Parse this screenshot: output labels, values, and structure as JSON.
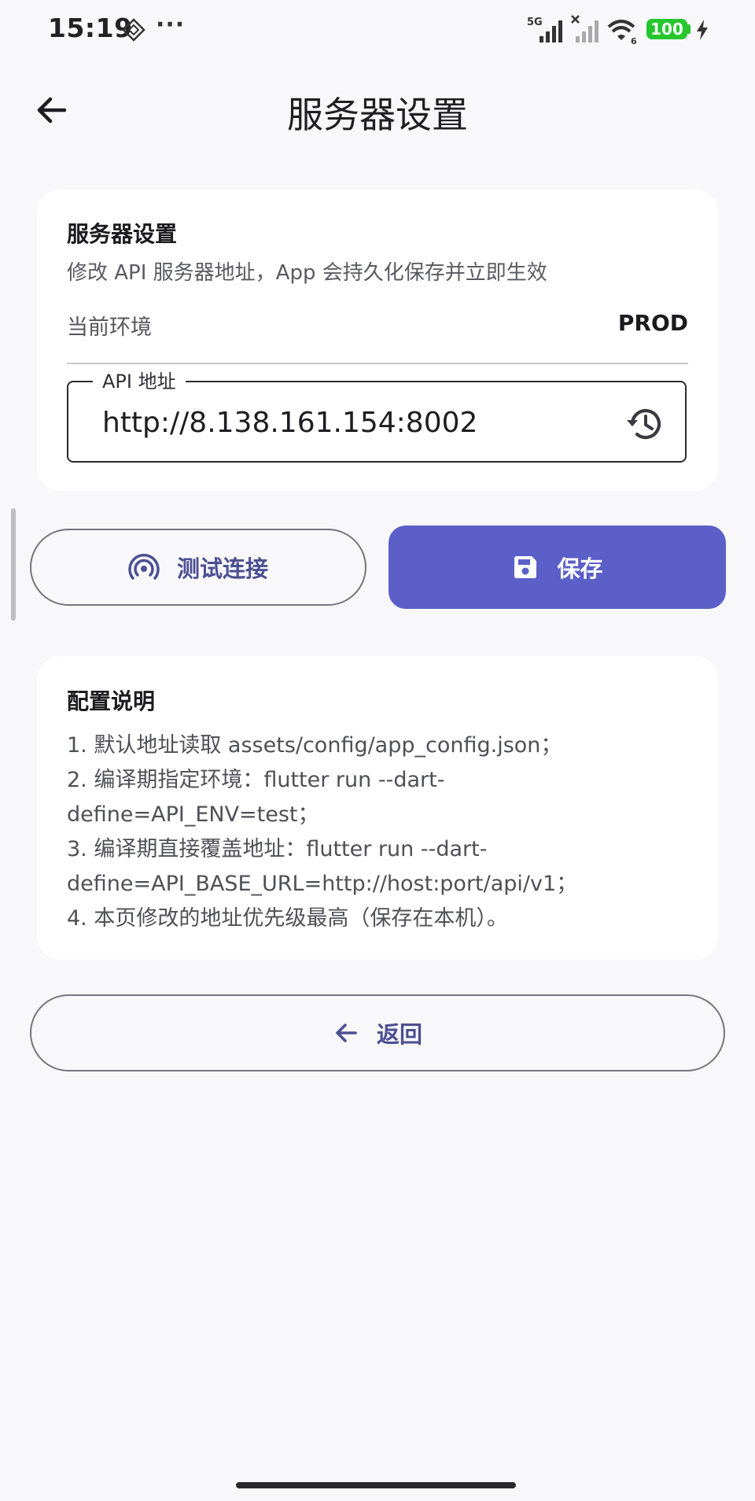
{
  "status_bar": {
    "time": "15:19",
    "more": "···",
    "network": "5G",
    "wifi_badge": "6",
    "battery": "100",
    "icons": [
      "sim-diamond-icon",
      "signal-icon",
      "no-signal-icon",
      "wifi-icon",
      "battery-icon",
      "charging-icon"
    ]
  },
  "app_bar": {
    "title": "服务器设置",
    "back_icon": "arrow-left-icon"
  },
  "settings_card": {
    "title": "服务器设置",
    "subtitle": "修改 API 服务器地址，App 会持久化保存并立即生效",
    "env_label": "当前环境",
    "env_value": "PROD",
    "field_label": "API 地址",
    "field_value": "http://8.138.161.154:8002",
    "history_icon": "history-icon"
  },
  "actions": {
    "test_label": "测试连接",
    "test_icon": "signal-waves-icon",
    "save_label": "保存",
    "save_icon": "save-icon"
  },
  "info_card": {
    "title": "配置说明",
    "lines": [
      "1. 默认地址读取 assets/config/app_config.json；",
      "2. 编译期指定环境：flutter run --dart-",
      "define=API_ENV=test；",
      "3. 编译期直接覆盖地址：flutter run --dart-",
      "define=API_BASE_URL=http://host:port/api/v1；",
      "4. 本页修改的地址优先级最高（保存在本机）。"
    ]
  },
  "footer": {
    "back_label": "返回",
    "back_icon": "arrow-left-icon"
  },
  "colors": {
    "accent": "#5c5fc8",
    "accent_text": "#4d4f92",
    "background": "#f8f8fb",
    "battery": "#25c72d"
  }
}
